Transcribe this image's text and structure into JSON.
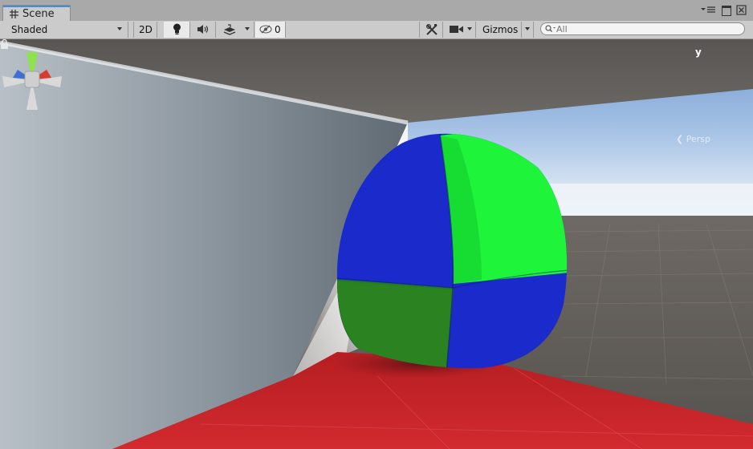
{
  "window": {
    "tab_label": "Scene",
    "icons": {
      "tab": "grid-icon",
      "menu": "window-menu-icon",
      "maximize": "maximize-icon",
      "close": "close-icon"
    }
  },
  "toolbar": {
    "draw_mode": "Shaded",
    "mode_2d": "2D",
    "lighting_icon": "lightbulb-icon",
    "audio_icon": "speaker-icon",
    "effects_icon": "layers-icon",
    "hidden_count": "0",
    "tools_icon": "tools-icon",
    "camera_icon": "camera-icon",
    "gizmos_label": "Gizmos",
    "search_placeholder": "All"
  },
  "viewport": {
    "projection_label": "Persp",
    "axis_label": "y",
    "colors": {
      "sky_top": "#6f96cf",
      "horizon": "#e9f1f8",
      "ground": "#5f5a55",
      "floor_red": "#c7242a",
      "wall": "#c9d0d6",
      "ball_green": "#1ef43a",
      "ball_blue": "#1a2acb"
    }
  }
}
